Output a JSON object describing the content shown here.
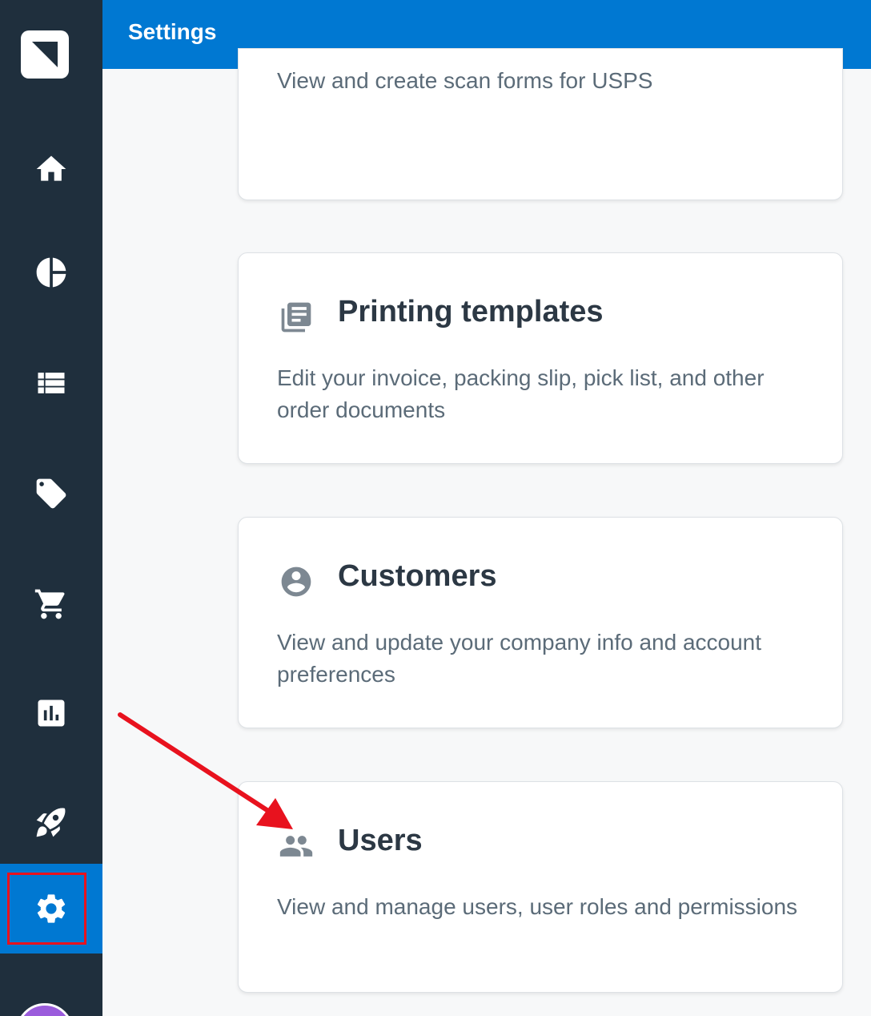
{
  "header": {
    "title": "Settings"
  },
  "sidebar": {
    "items": [
      {
        "icon": "home-icon"
      },
      {
        "icon": "pie-chart-icon"
      },
      {
        "icon": "list-icon"
      },
      {
        "icon": "tag-icon"
      },
      {
        "icon": "cart-icon"
      },
      {
        "icon": "bar-chart-icon"
      },
      {
        "icon": "rocket-icon"
      },
      {
        "icon": "gear-icon",
        "active": true
      }
    ]
  },
  "cards": [
    {
      "description": "View and create scan forms for USPS"
    },
    {
      "icon": "documents-icon",
      "title": "Printing templates",
      "description": "Edit your invoice, packing slip, pick list, and other order documents"
    },
    {
      "icon": "account-circle-icon",
      "title": "Customers",
      "description": "View and update your company info and account preferences"
    },
    {
      "icon": "users-icon",
      "title": "Users",
      "description": "View and manage users, user roles and permissions"
    }
  ],
  "colors": {
    "sidebar_bg": "#1f2f3d",
    "accent": "#0078d2",
    "annotation": "#e8121e"
  }
}
